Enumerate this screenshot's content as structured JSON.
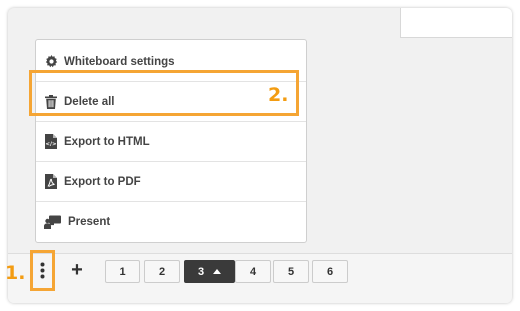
{
  "menu": {
    "items": [
      {
        "label": "Whiteboard settings",
        "icon": "gear-icon"
      },
      {
        "label": "Delete all",
        "icon": "trash-icon"
      },
      {
        "label": "Export to HTML",
        "icon": "html-file-icon"
      },
      {
        "label": "Export to PDF",
        "icon": "pdf-file-icon"
      },
      {
        "label": "Present",
        "icon": "present-icon"
      }
    ]
  },
  "annotations": {
    "step_1": "1.",
    "step_2": "2."
  },
  "toolbar": {
    "add_label": "+",
    "pages": [
      "1",
      "2",
      "3",
      "4",
      "5",
      "6"
    ],
    "active_page": "3"
  },
  "colors": {
    "highlight": "#f5a534",
    "active_page_bg": "#3a3a3a",
    "text": "#444444"
  }
}
